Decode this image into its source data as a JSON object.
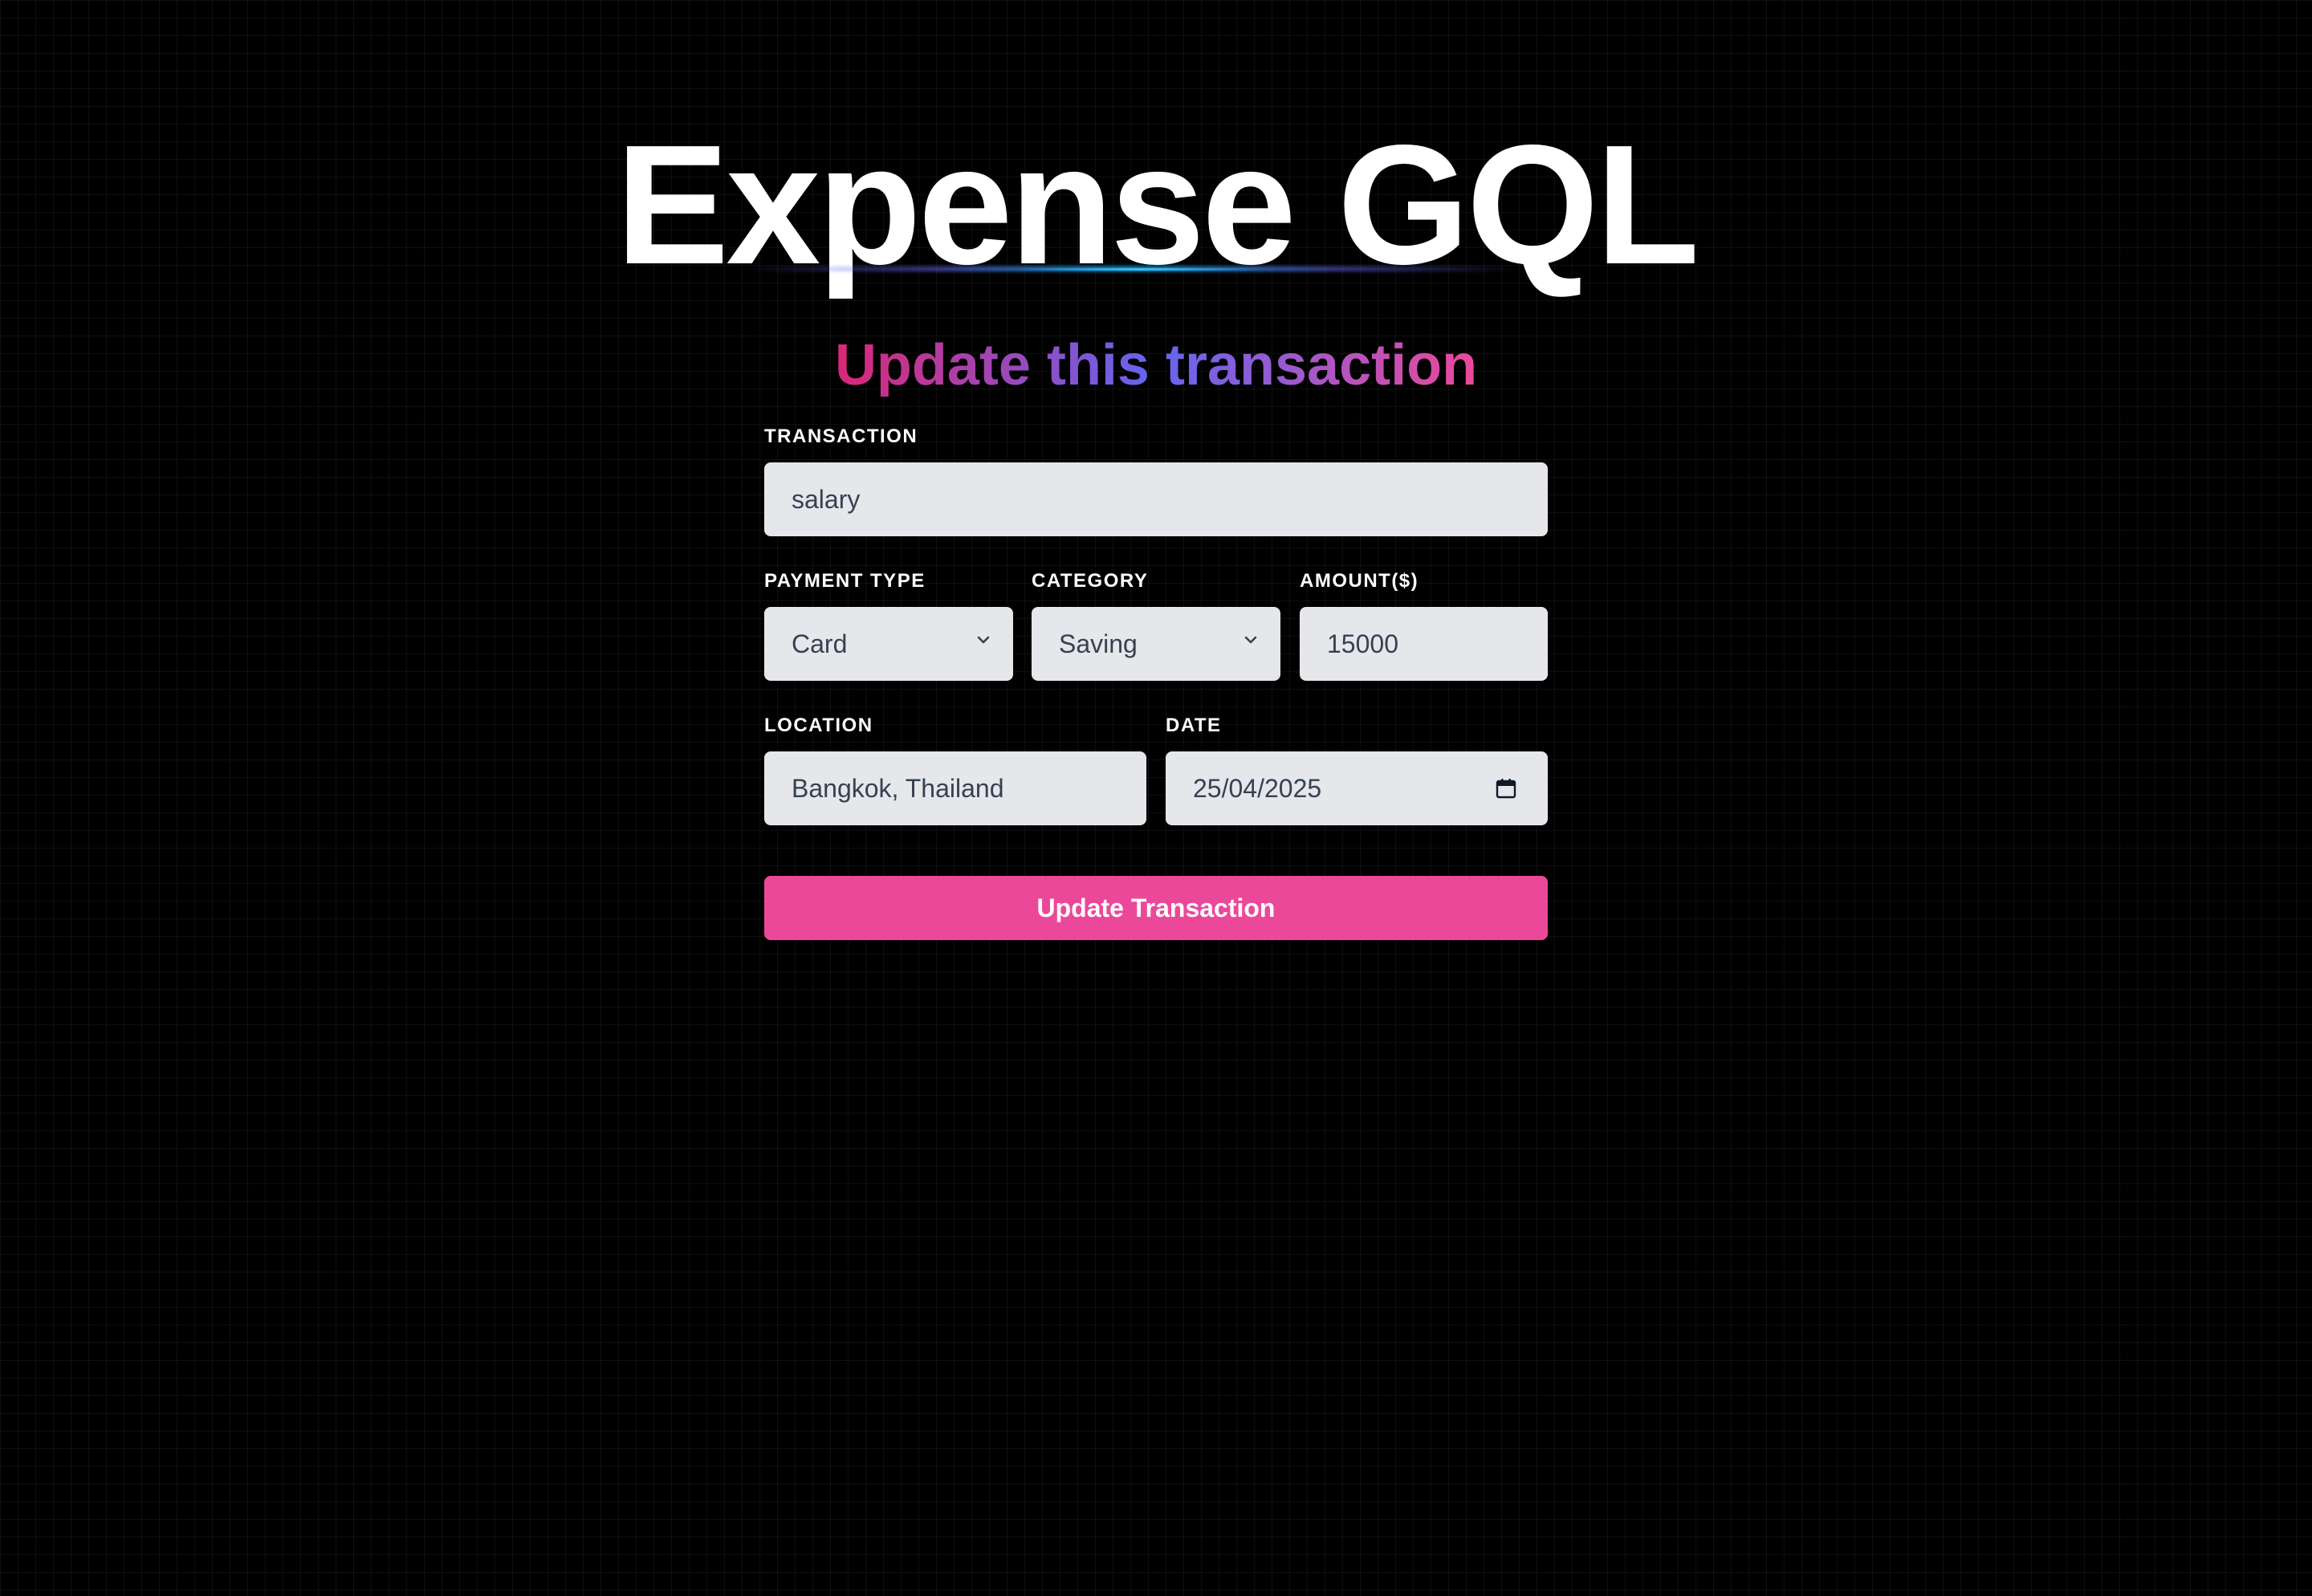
{
  "app": {
    "title": "Expense GQL"
  },
  "form": {
    "heading": "Update this transaction",
    "transaction": {
      "label": "TRANSACTION",
      "value": "salary"
    },
    "payment_type": {
      "label": "PAYMENT TYPE",
      "value": "Card"
    },
    "category": {
      "label": "CATEGORY",
      "value": "Saving"
    },
    "amount": {
      "label": "AMOUNT($)",
      "value": "15000"
    },
    "location": {
      "label": "LOCATION",
      "value": "Bangkok, Thailand"
    },
    "date": {
      "label": "DATE",
      "value": "25/04/2025"
    },
    "submit_label": "Update Transaction"
  },
  "icons": {
    "select_arrow": "chevron-down-icon",
    "date_picker": "calendar-icon"
  },
  "colors": {
    "background": "#000000",
    "input_background": "#e5e7eb",
    "button": "#ec4899",
    "heading_gradient": [
      "#db2777",
      "#6366f1",
      "#ec4899"
    ],
    "title_glow": "#0ea5e9"
  }
}
